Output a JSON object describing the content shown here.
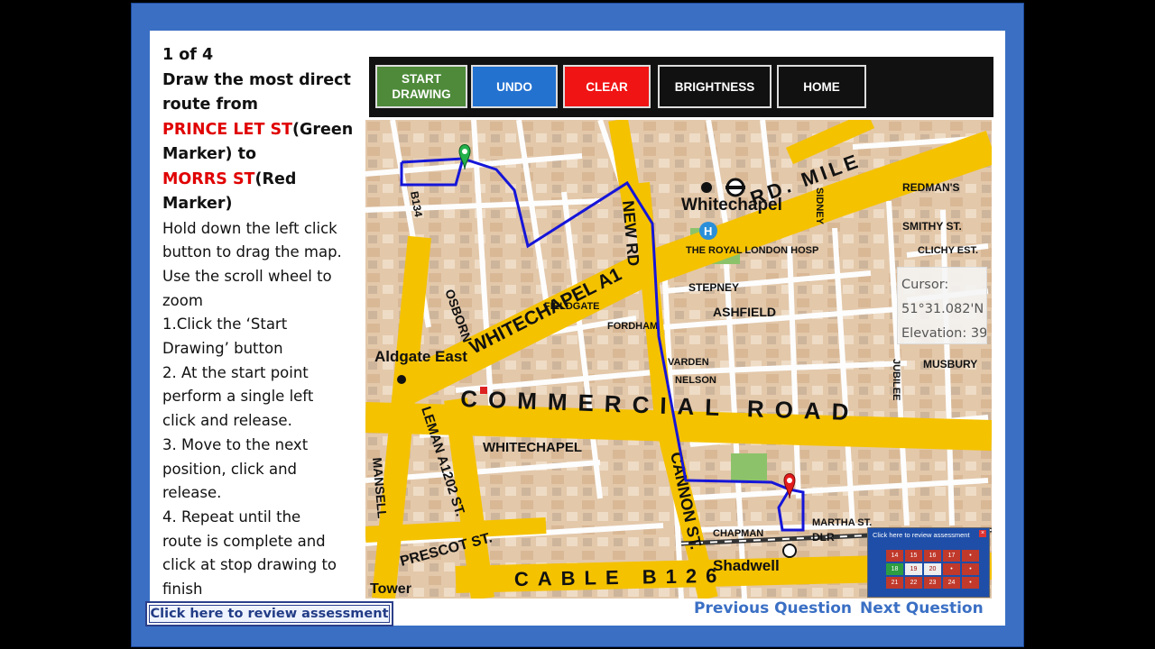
{
  "instructions": {
    "counter": "1 of 4",
    "line1": "Draw the most direct",
    "line2": "route from",
    "start_street": "PRINCE LET ST",
    "start_marker": "(Green",
    "start_marker2": "Marker) to",
    "end_street": "MORRS ST",
    "end_marker": "(Red",
    "end_marker2": "Marker)",
    "steps": [
      "Hold down the left click",
      "button to drag the map.",
      "Use the scroll wheel to",
      "zoom",
      "1.Click the ‘Start",
      "Drawing’ button",
      "2. At the start point",
      "perform a single left",
      "click and release.",
      "3. Move to the next",
      "position, click and",
      "release.",
      "4. Repeat until the",
      "route is complete and",
      "click at stop drawing to",
      "finish"
    ]
  },
  "toolbar": {
    "start_line1": "START",
    "start_line2": "DRAWING",
    "undo": "UNDO",
    "clear": "CLEAR",
    "brightness": "BRIGHTNESS",
    "home": "HOME",
    "colors": {
      "start": "#4e8a3a",
      "undo": "#2372d0",
      "clear": "#f01414",
      "dark": "#111111"
    }
  },
  "map": {
    "labels": {
      "whitechapel_rd": "WHITECHAPEL A1",
      "commercial_rd": "COMMERCIAL ROAD",
      "mile_end": "RD. MILE",
      "new_rd": "NEW RD",
      "cannon_st": "CANNON ST.",
      "cable_st": "CABLE B126",
      "whitechapel_station": "Whitechapel",
      "royal_london": "THE ROYAL LONDON HOSP",
      "aldgate_east": "Aldgate East",
      "whitechapel_area": "WHITECHAPEL",
      "shadwell": "Shadwell",
      "prescot": "PRESCOT ST.",
      "leman": "LEMAN A1202 ST.",
      "osborn": "OSBORN",
      "mansell": "MANSELL",
      "tower": "Tower",
      "ashfield": "ASHFIELD",
      "stepney": "STEPNEY",
      "fieldgate": "FIELDGATE",
      "fordham": "FORDHAM",
      "varden": "VARDEN",
      "nelson": "NELSON",
      "sidney": "SIDNEY",
      "smithy": "SMITHY ST.",
      "clichy": "CLICHY EST.",
      "redmans": "REDMAN'S",
      "jubilee": "JUBILEE",
      "musbury": "MUSBURY",
      "martha": "MARTHA ST.",
      "chapman": "CHAPMAN",
      "dlr": "DLR",
      "b134": "B134"
    },
    "cursor": {
      "label": "Cursor:",
      "coord": "51°31.082'N",
      "elevation": "Elevation: 39"
    },
    "review_widget": {
      "title": "Click here to review assessment",
      "cells": [
        "14",
        "15",
        "16",
        "17",
        "•",
        "18",
        "19",
        "20",
        "•",
        "•",
        "21",
        "22",
        "23",
        "24",
        "•"
      ]
    }
  },
  "footer": {
    "review_button": "Click here to review assessment",
    "previous": "Previous Question",
    "next": "Next Question"
  }
}
